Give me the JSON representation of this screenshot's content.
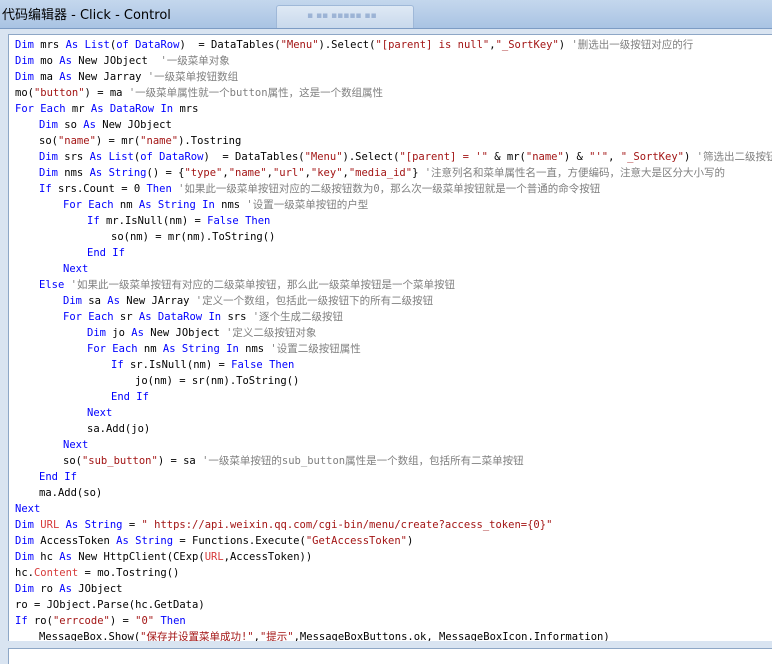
{
  "window": {
    "title": "代码编辑器 - Click - Control"
  },
  "code_lines": [
    {
      "indent": 0,
      "tokens": [
        {
          "t": "kw",
          "v": "Dim"
        },
        {
          "t": "p",
          "v": " mrs "
        },
        {
          "t": "kw",
          "v": "As"
        },
        {
          "t": "p",
          "v": " "
        },
        {
          "t": "kw",
          "v": "List"
        },
        {
          "t": "p",
          "v": "("
        },
        {
          "t": "kw",
          "v": "of"
        },
        {
          "t": "p",
          "v": " "
        },
        {
          "t": "kw",
          "v": "DataRow"
        },
        {
          "t": "p",
          "v": ")  = DataTables("
        },
        {
          "t": "str",
          "v": "\"Menu\""
        },
        {
          "t": "p",
          "v": ").Select("
        },
        {
          "t": "str",
          "v": "\"[parent] is null\""
        },
        {
          "t": "p",
          "v": ","
        },
        {
          "t": "str",
          "v": "\"_SortKey\""
        },
        {
          "t": "p",
          "v": ") "
        },
        {
          "t": "cmt",
          "v": "'删选出一级按钮对应的行"
        }
      ]
    },
    {
      "indent": 0,
      "tokens": [
        {
          "t": "kw",
          "v": "Dim"
        },
        {
          "t": "p",
          "v": " mo "
        },
        {
          "t": "kw",
          "v": "As"
        },
        {
          "t": "p",
          "v": " New JObject  "
        },
        {
          "t": "cmt",
          "v": "'一级菜单对象"
        }
      ]
    },
    {
      "indent": 0,
      "tokens": [
        {
          "t": "kw",
          "v": "Dim"
        },
        {
          "t": "p",
          "v": " ma "
        },
        {
          "t": "kw",
          "v": "As"
        },
        {
          "t": "p",
          "v": " New Jarray "
        },
        {
          "t": "cmt",
          "v": "'一级菜单按钮数组"
        }
      ]
    },
    {
      "indent": 0,
      "tokens": [
        {
          "t": "p",
          "v": "mo("
        },
        {
          "t": "str",
          "v": "\"button\""
        },
        {
          "t": "p",
          "v": ") = ma "
        },
        {
          "t": "cmt",
          "v": "'一级菜单属性就一个button属性，这是一个数组属性"
        }
      ]
    },
    {
      "indent": 0,
      "tokens": [
        {
          "t": "kw",
          "v": "For"
        },
        {
          "t": "p",
          "v": " "
        },
        {
          "t": "kw",
          "v": "Each"
        },
        {
          "t": "p",
          "v": " mr "
        },
        {
          "t": "kw",
          "v": "As"
        },
        {
          "t": "p",
          "v": " "
        },
        {
          "t": "kw",
          "v": "DataRow"
        },
        {
          "t": "p",
          "v": " "
        },
        {
          "t": "kw",
          "v": "In"
        },
        {
          "t": "p",
          "v": " mrs"
        }
      ]
    },
    {
      "indent": 1,
      "tokens": [
        {
          "t": "kw",
          "v": "Dim"
        },
        {
          "t": "p",
          "v": " so "
        },
        {
          "t": "kw",
          "v": "As"
        },
        {
          "t": "p",
          "v": " New JObject"
        }
      ]
    },
    {
      "indent": 1,
      "tokens": [
        {
          "t": "p",
          "v": "so("
        },
        {
          "t": "str",
          "v": "\"name\""
        },
        {
          "t": "p",
          "v": ") = mr("
        },
        {
          "t": "str",
          "v": "\"name\""
        },
        {
          "t": "p",
          "v": ").Tostring"
        }
      ]
    },
    {
      "indent": 1,
      "tokens": [
        {
          "t": "kw",
          "v": "Dim"
        },
        {
          "t": "p",
          "v": " srs "
        },
        {
          "t": "kw",
          "v": "As"
        },
        {
          "t": "p",
          "v": " "
        },
        {
          "t": "kw",
          "v": "List"
        },
        {
          "t": "p",
          "v": "("
        },
        {
          "t": "kw",
          "v": "of"
        },
        {
          "t": "p",
          "v": " "
        },
        {
          "t": "kw",
          "v": "DataRow"
        },
        {
          "t": "p",
          "v": ")  = DataTables("
        },
        {
          "t": "str",
          "v": "\"Menu\""
        },
        {
          "t": "p",
          "v": ").Select("
        },
        {
          "t": "str",
          "v": "\"[parent] = '\""
        },
        {
          "t": "p",
          "v": " & mr("
        },
        {
          "t": "str",
          "v": "\"name\""
        },
        {
          "t": "p",
          "v": ") & "
        },
        {
          "t": "str",
          "v": "\"'\""
        },
        {
          "t": "p",
          "v": ", "
        },
        {
          "t": "str",
          "v": "\"_SortKey\""
        },
        {
          "t": "p",
          "v": ") "
        },
        {
          "t": "cmt",
          "v": "'筛选出二级按钮"
        }
      ]
    },
    {
      "indent": 1,
      "tokens": [
        {
          "t": "kw",
          "v": "Dim"
        },
        {
          "t": "p",
          "v": " nms "
        },
        {
          "t": "kw",
          "v": "As"
        },
        {
          "t": "p",
          "v": " "
        },
        {
          "t": "kw",
          "v": "String"
        },
        {
          "t": "p",
          "v": "() = {"
        },
        {
          "t": "str",
          "v": "\"type\""
        },
        {
          "t": "p",
          "v": ","
        },
        {
          "t": "str",
          "v": "\"name\""
        },
        {
          "t": "p",
          "v": ","
        },
        {
          "t": "str",
          "v": "\"url\""
        },
        {
          "t": "p",
          "v": ","
        },
        {
          "t": "str",
          "v": "\"key\""
        },
        {
          "t": "p",
          "v": ","
        },
        {
          "t": "str",
          "v": "\"media_id\""
        },
        {
          "t": "p",
          "v": "} "
        },
        {
          "t": "cmt",
          "v": "'注意列名和菜单属性名一直，方便编码，注意大是区分大小写的"
        }
      ]
    },
    {
      "indent": 1,
      "tokens": [
        {
          "t": "kw",
          "v": "If"
        },
        {
          "t": "p",
          "v": " srs.Count = 0 "
        },
        {
          "t": "kw",
          "v": "Then"
        },
        {
          "t": "p",
          "v": " "
        },
        {
          "t": "cmt",
          "v": "'如果此一级菜单按钮对应的二级按钮数为0，那么次一级菜单按钮就是一个普通的命令按钮"
        }
      ]
    },
    {
      "indent": 2,
      "tokens": [
        {
          "t": "kw",
          "v": "For"
        },
        {
          "t": "p",
          "v": " "
        },
        {
          "t": "kw",
          "v": "Each"
        },
        {
          "t": "p",
          "v": " nm "
        },
        {
          "t": "kw",
          "v": "As"
        },
        {
          "t": "p",
          "v": " "
        },
        {
          "t": "kw",
          "v": "String"
        },
        {
          "t": "p",
          "v": " "
        },
        {
          "t": "kw",
          "v": "In"
        },
        {
          "t": "p",
          "v": " nms "
        },
        {
          "t": "cmt",
          "v": "'设置一级菜单按钮的户型"
        }
      ]
    },
    {
      "indent": 3,
      "tokens": [
        {
          "t": "kw",
          "v": "If"
        },
        {
          "t": "p",
          "v": " mr.IsNull(nm) = "
        },
        {
          "t": "kw",
          "v": "False"
        },
        {
          "t": "p",
          "v": " "
        },
        {
          "t": "kw",
          "v": "Then"
        }
      ]
    },
    {
      "indent": 4,
      "tokens": [
        {
          "t": "p",
          "v": "so(nm) = mr(nm).ToString()"
        }
      ]
    },
    {
      "indent": 3,
      "tokens": [
        {
          "t": "kw",
          "v": "End"
        },
        {
          "t": "p",
          "v": " "
        },
        {
          "t": "kw",
          "v": "If"
        }
      ]
    },
    {
      "indent": 2,
      "tokens": [
        {
          "t": "kw",
          "v": "Next"
        }
      ]
    },
    {
      "indent": 1,
      "tokens": [
        {
          "t": "kw",
          "v": "Else"
        },
        {
          "t": "p",
          "v": " "
        },
        {
          "t": "cmt",
          "v": "'如果此一级菜单按钮有对应的二级菜单按钮，那么此一级菜单按钮是一个菜单按钮"
        }
      ]
    },
    {
      "indent": 2,
      "tokens": [
        {
          "t": "kw",
          "v": "Dim"
        },
        {
          "t": "p",
          "v": " sa "
        },
        {
          "t": "kw",
          "v": "As"
        },
        {
          "t": "p",
          "v": " New JArray "
        },
        {
          "t": "cmt",
          "v": "'定义一个数组，包括此一级按钮下的所有二级按钮"
        }
      ]
    },
    {
      "indent": 2,
      "tokens": [
        {
          "t": "kw",
          "v": "For"
        },
        {
          "t": "p",
          "v": " "
        },
        {
          "t": "kw",
          "v": "Each"
        },
        {
          "t": "p",
          "v": " sr "
        },
        {
          "t": "kw",
          "v": "As"
        },
        {
          "t": "p",
          "v": " "
        },
        {
          "t": "kw",
          "v": "DataRow"
        },
        {
          "t": "p",
          "v": " "
        },
        {
          "t": "kw",
          "v": "In"
        },
        {
          "t": "p",
          "v": " srs "
        },
        {
          "t": "cmt",
          "v": "'逐个生成二级按钮"
        }
      ]
    },
    {
      "indent": 3,
      "tokens": [
        {
          "t": "kw",
          "v": "Dim"
        },
        {
          "t": "p",
          "v": " jo "
        },
        {
          "t": "kw",
          "v": "As"
        },
        {
          "t": "p",
          "v": " New JObject "
        },
        {
          "t": "cmt",
          "v": "'定义二级按钮对象"
        }
      ]
    },
    {
      "indent": 3,
      "tokens": [
        {
          "t": "kw",
          "v": "For"
        },
        {
          "t": "p",
          "v": " "
        },
        {
          "t": "kw",
          "v": "Each"
        },
        {
          "t": "p",
          "v": " nm "
        },
        {
          "t": "kw",
          "v": "As"
        },
        {
          "t": "p",
          "v": " "
        },
        {
          "t": "kw",
          "v": "String"
        },
        {
          "t": "p",
          "v": " "
        },
        {
          "t": "kw",
          "v": "In"
        },
        {
          "t": "p",
          "v": " nms "
        },
        {
          "t": "cmt",
          "v": "'设置二级按钮属性"
        }
      ]
    },
    {
      "indent": 4,
      "tokens": [
        {
          "t": "kw",
          "v": "If"
        },
        {
          "t": "p",
          "v": " sr.IsNull(nm) = "
        },
        {
          "t": "kw",
          "v": "False"
        },
        {
          "t": "p",
          "v": " "
        },
        {
          "t": "kw",
          "v": "Then"
        }
      ]
    },
    {
      "indent": 5,
      "tokens": [
        {
          "t": "p",
          "v": "jo(nm) = sr(nm).ToString()"
        }
      ]
    },
    {
      "indent": 4,
      "tokens": [
        {
          "t": "kw",
          "v": "End"
        },
        {
          "t": "p",
          "v": " "
        },
        {
          "t": "kw",
          "v": "If"
        }
      ]
    },
    {
      "indent": 3,
      "tokens": [
        {
          "t": "kw",
          "v": "Next"
        }
      ]
    },
    {
      "indent": 3,
      "tokens": [
        {
          "t": "p",
          "v": "sa.Add(jo)"
        }
      ]
    },
    {
      "indent": 2,
      "tokens": [
        {
          "t": "kw",
          "v": "Next"
        }
      ]
    },
    {
      "indent": 2,
      "tokens": [
        {
          "t": "p",
          "v": "so("
        },
        {
          "t": "str",
          "v": "\"sub_button\""
        },
        {
          "t": "p",
          "v": ") = sa "
        },
        {
          "t": "cmt",
          "v": "'一级菜单按钮的sub_button属性是一个数组，包括所有二菜单按钮"
        }
      ]
    },
    {
      "indent": 1,
      "tokens": [
        {
          "t": "kw",
          "v": "End"
        },
        {
          "t": "p",
          "v": " "
        },
        {
          "t": "kw",
          "v": "If"
        }
      ]
    },
    {
      "indent": 1,
      "tokens": [
        {
          "t": "p",
          "v": "ma.Add(so)"
        }
      ]
    },
    {
      "indent": 0,
      "tokens": [
        {
          "t": "kw",
          "v": "Next"
        }
      ]
    },
    {
      "indent": 0,
      "tokens": [
        {
          "t": "kw",
          "v": "Dim"
        },
        {
          "t": "p",
          "v": " "
        },
        {
          "t": "red",
          "v": "URL"
        },
        {
          "t": "p",
          "v": " "
        },
        {
          "t": "kw",
          "v": "As"
        },
        {
          "t": "p",
          "v": " "
        },
        {
          "t": "kw",
          "v": "String"
        },
        {
          "t": "p",
          "v": " = "
        },
        {
          "t": "str",
          "v": "\" https://api.weixin.qq.com/cgi-bin/menu/create?access_token={0}\""
        }
      ]
    },
    {
      "indent": 0,
      "tokens": [
        {
          "t": "kw",
          "v": "Dim"
        },
        {
          "t": "p",
          "v": " AccessToken "
        },
        {
          "t": "kw",
          "v": "As"
        },
        {
          "t": "p",
          "v": " "
        },
        {
          "t": "kw",
          "v": "String"
        },
        {
          "t": "p",
          "v": " = Functions.Execute("
        },
        {
          "t": "str",
          "v": "\"GetAccessToken\""
        },
        {
          "t": "p",
          "v": ")"
        }
      ]
    },
    {
      "indent": 0,
      "tokens": [
        {
          "t": "kw",
          "v": "Dim"
        },
        {
          "t": "p",
          "v": " hc "
        },
        {
          "t": "kw",
          "v": "As"
        },
        {
          "t": "p",
          "v": " New HttpClient(CExp("
        },
        {
          "t": "red",
          "v": "URL"
        },
        {
          "t": "p",
          "v": ",AccessToken))"
        }
      ]
    },
    {
      "indent": 0,
      "tokens": [
        {
          "t": "p",
          "v": "hc."
        },
        {
          "t": "red",
          "v": "Content"
        },
        {
          "t": "p",
          "v": " = mo.Tostring()"
        }
      ]
    },
    {
      "indent": 0,
      "tokens": [
        {
          "t": "kw",
          "v": "Dim"
        },
        {
          "t": "p",
          "v": " ro "
        },
        {
          "t": "kw",
          "v": "As"
        },
        {
          "t": "p",
          "v": " JObject"
        }
      ]
    },
    {
      "indent": 0,
      "tokens": [
        {
          "t": "p",
          "v": "ro = JObject.Parse(hc.GetData)"
        }
      ]
    },
    {
      "indent": 0,
      "tokens": [
        {
          "t": "kw",
          "v": "If"
        },
        {
          "t": "p",
          "v": " ro("
        },
        {
          "t": "str",
          "v": "\"errcode\""
        },
        {
          "t": "p",
          "v": ") = "
        },
        {
          "t": "str",
          "v": "\"0\""
        },
        {
          "t": "p",
          "v": " "
        },
        {
          "t": "kw",
          "v": "Then"
        }
      ]
    },
    {
      "indent": 1,
      "tokens": [
        {
          "t": "p",
          "v": "MessageBox.Show("
        },
        {
          "t": "str",
          "v": "\"保存并设置菜单成功!\""
        },
        {
          "t": "p",
          "v": ","
        },
        {
          "t": "str",
          "v": "\"提示\""
        },
        {
          "t": "p",
          "v": ",MessageBoxButtons.ok, MessageBoxIcon.Information)"
        }
      ]
    }
  ]
}
